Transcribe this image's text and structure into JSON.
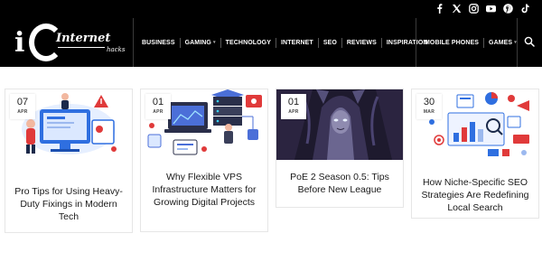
{
  "header": {
    "socials": [
      {
        "name": "facebook-icon",
        "glyph": "f"
      },
      {
        "name": "x-twitter-icon",
        "glyph": "X"
      },
      {
        "name": "instagram-icon",
        "glyph": ""
      },
      {
        "name": "youtube-icon",
        "glyph": ""
      },
      {
        "name": "pinterest-icon",
        "glyph": ""
      },
      {
        "name": "tiktok-icon",
        "glyph": ""
      }
    ],
    "logo": {
      "mark": "i",
      "word": "Internet",
      "sub": "hacks"
    },
    "nav_group1": [
      {
        "label": "BUSINESS",
        "caret": false
      },
      {
        "label": "GAMING",
        "caret": true
      },
      {
        "label": "TECHNOLOGY",
        "caret": false
      },
      {
        "label": "INTERNET",
        "caret": false
      },
      {
        "label": "SEO",
        "caret": false
      },
      {
        "label": "REVIEWS",
        "caret": false
      },
      {
        "label": "INSPIRATION",
        "caret": false
      }
    ],
    "nav_group2": [
      {
        "label": "MOBILE PHONES",
        "caret": false
      },
      {
        "label": "GAMES",
        "caret": true
      }
    ]
  },
  "posts": [
    {
      "day": "07",
      "month": "APR",
      "title": "Pro Tips for Using Heavy-Duty Fixings in Modern Tech",
      "image": "tech-workers-illustration"
    },
    {
      "day": "01",
      "month": "APR",
      "title": "Why Flexible VPS Infrastructure Matters for Growing Digital Projects",
      "image": "server-infrastructure-illustration"
    },
    {
      "day": "01",
      "month": "APR",
      "title": "PoE 2 Season 0.5: Tips Before New League",
      "image": "dark-fantasy-character-art"
    },
    {
      "day": "30",
      "month": "MAR",
      "title": "How Niche-Specific SEO Strategies Are Redefining Local Search",
      "image": "seo-analytics-illustration"
    }
  ],
  "colors": {
    "header_bg": "#000000",
    "text": "#1a1a1a",
    "accent_red": "#e03a3a",
    "accent_blue": "#2f6fe0"
  }
}
